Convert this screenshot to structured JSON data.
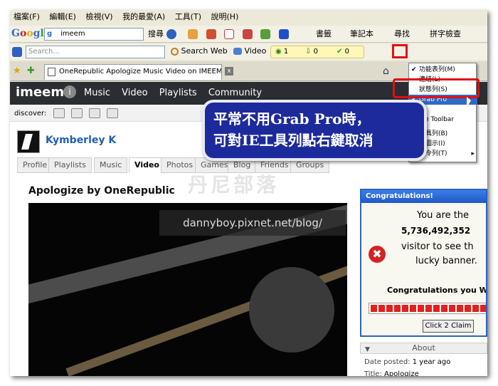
{
  "menubar": [
    "檔案(F)",
    "編輯(E)",
    "檢視(V)",
    "我的最愛(A)",
    "工具(T)",
    "說明(H)"
  ],
  "google_toolbar": {
    "logo": "Google",
    "query": "imeem",
    "search_label": "搜尋",
    "bookmarks_label": "書籤",
    "notebook_label": "筆記本",
    "find_label": "尋找",
    "spellcheck_label": "拼字檢查"
  },
  "search_toolbar": {
    "placeholder": "Search...",
    "search_web_label": "Search Web",
    "video_label": "Video",
    "counter_1": "1",
    "counter_2": "0",
    "counter_3": "0"
  },
  "browser_tab": {
    "title": "OneRepublic Apologize Music Video on IMEEM Video"
  },
  "imeem": {
    "logo": "imeem",
    "info": "i",
    "nav": [
      "Music",
      "Video",
      "Playlists",
      "Community"
    ],
    "discover_label": "discover:"
  },
  "profile": {
    "name": "Kymberley K",
    "tabs": [
      "Profile",
      "Playlists",
      "Music",
      "Video",
      "Photos",
      "Games",
      "Blog",
      "Friends",
      "Groups"
    ],
    "active_tab": "Video"
  },
  "video": {
    "title": "Apologize by OneRepublic",
    "watermark": "dannyboy.pixnet.net/blog/"
  },
  "banner": {
    "title": "Congratulations!",
    "line1": "You are the",
    "number": "5,736,492,352",
    "line2": "visitor to see th",
    "line3": "lucky banner.",
    "line4": "Congratulations you W",
    "button": "Click 2 Claim"
  },
  "about": {
    "title": "About",
    "date_label": "Date posted:",
    "date_value": "1 year ago",
    "title_label": "Title:",
    "title_value": "Apologize"
  },
  "context_menu": [
    {
      "label": "功能表列(M)",
      "checked": true,
      "submenu": false
    },
    {
      "label": "連結(L)",
      "checked": false,
      "submenu": false
    },
    {
      "label": "狀態列(S)",
      "checked": false,
      "submenu": false
    },
    {
      "label": "Grab Pro",
      "checked": true,
      "submenu": false
    },
    {
      "label": "gle Toolbar",
      "checked": false,
      "submenu": false
    },
    {
      "label": "工具列(B)",
      "checked": false,
      "submenu": false
    },
    {
      "label": "大圖示(I)",
      "checked": false,
      "submenu": false
    },
    {
      "label": "命令列(T)",
      "checked": false,
      "submenu": true
    }
  ],
  "callout": {
    "line1": "平常不用Grab Pro時，",
    "line2": "可對IE工具列點右鍵取消"
  },
  "blog_mark": "丹尼部落",
  "accent_colors": {
    "annotation_red": "#e01010",
    "callout_bg": "#1c2a9c",
    "link_blue": "#1e5fb6"
  }
}
